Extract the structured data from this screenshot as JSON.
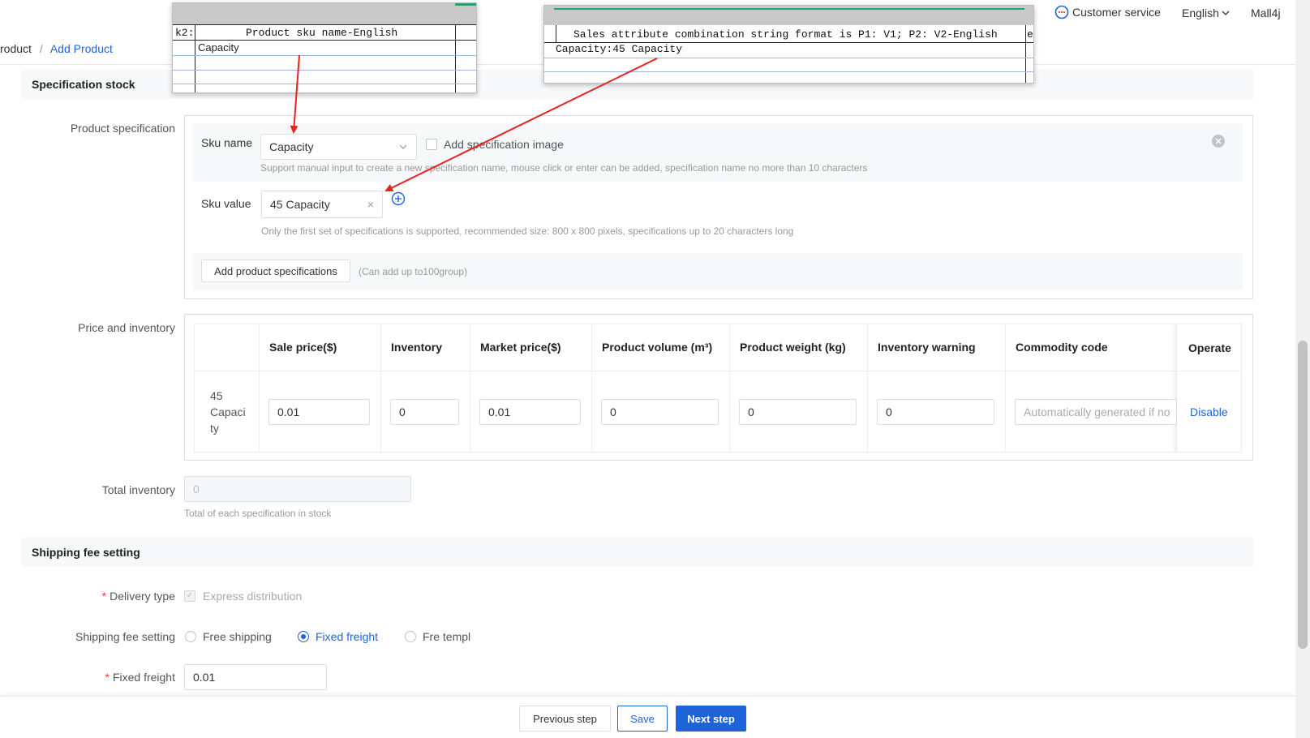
{
  "header": {
    "breadcrumb": [
      "roduct",
      "Add Product"
    ],
    "breadcrumb_sep": "/",
    "customer_service": "Customer service",
    "language": "English",
    "user": "Mall4j"
  },
  "overlay_left": {
    "cell_ref": "k2:",
    "header": "Product sku name-English",
    "value": "Capacity"
  },
  "overlay_right": {
    "header": "Sales attribute combination string format is P1: V1; P2: V2-English",
    "trail": "e",
    "value": "Capacity:45 Capacity"
  },
  "spec": {
    "section_title": "Specification stock",
    "product_spec_label": "Product specification",
    "sku_name_label": "Sku name",
    "sku_name_value": "Capacity",
    "add_image_label": "Add specification image",
    "sku_name_hint": "Support manual input to create a new specification name, mouse click or enter can be added, specification name no more than 10 characters",
    "sku_value_label": "Sku value",
    "sku_value_tag": "45 Capacity",
    "sku_value_hint": "Only the first set of specifications is supported, recommended size: 800 x 800 pixels, specifications up to 20 characters long",
    "add_spec_button": "Add product specifications",
    "add_spec_hint": "(Can add up to100group)"
  },
  "price": {
    "label": "Price and inventory",
    "columns": [
      "Sale price($)",
      "Inventory",
      "Market price($)",
      "Product volume (m³)",
      "Product weight (kg)",
      "Inventory warning",
      "Commodity code",
      "Operate"
    ],
    "row": {
      "name_lines": [
        "45",
        "Capaci",
        "ty"
      ],
      "sale_price": "0.01",
      "inventory": "0",
      "market_price": "0.01",
      "volume": "0",
      "weight": "0",
      "warning": "0",
      "code_placeholder": "Automatically generated if no",
      "operate": "Disable"
    }
  },
  "total": {
    "label": "Total inventory",
    "value": "0",
    "hint": "Total of each specification in stock"
  },
  "shipping": {
    "section_title": "Shipping fee setting",
    "delivery_label": "Delivery type",
    "delivery_option": "Express distribution",
    "fee_label": "Shipping fee setting",
    "options": [
      "Free shipping",
      "Fixed freight",
      "Fre templ"
    ],
    "selected_index": 1,
    "fixed_label": "Fixed freight",
    "fixed_value": "0.01"
  },
  "footer": {
    "previous": "Previous step",
    "save": "Save",
    "next": "Next step"
  },
  "colors": {
    "primary": "#1f63d9",
    "annotation_arrow": "#e8231f",
    "required": "#e4393c"
  }
}
